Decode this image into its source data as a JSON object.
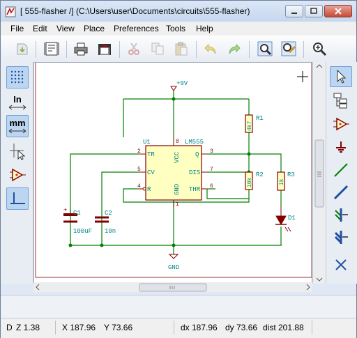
{
  "window": {
    "title": "[ 555-flasher /] (C:\\Users\\user\\Documents\\circuits\\555-flasher)"
  },
  "menu": [
    "File",
    "Edit",
    "View",
    "Place",
    "Preferences",
    "Tools",
    "Help"
  ],
  "toolbar": {
    "icons": [
      "new-sheet-icon",
      "page-settings-icon",
      "print-icon",
      "plot-icon",
      "cut-icon",
      "copy-icon",
      "paste-icon",
      "undo-icon",
      "redo-icon",
      "find-icon",
      "find-replace-icon",
      "zoom-icon"
    ]
  },
  "left_toolbar": {
    "grid_icon": "grid-icon",
    "units_in": "In",
    "units_mm": "mm",
    "cursor_icon": "full-cursor-icon",
    "hier_icon": "hidden-pins-icon",
    "wire_angle_icon": "wire-angle-icon"
  },
  "right_toolbar": {
    "icons": [
      "select-arrow-icon",
      "hierarchy-icon",
      "add-component-icon",
      "add-power-icon",
      "add-wire-icon",
      "add-bus-icon",
      "wire-to-bus-entry-icon",
      "bus-to-bus-entry-icon",
      "no-connect-icon"
    ]
  },
  "schematic": {
    "vcc_label": "+9V",
    "gnd_label": "GND",
    "u1_ref": "U1",
    "u1_value": "LM555",
    "pin_numbers": {
      "tr": "2",
      "cv": "5",
      "r": "4",
      "q": "3",
      "dis": "7",
      "thr": "6",
      "vcc": "8",
      "gnd": "1"
    },
    "pin_names": {
      "tr": "TR",
      "cv": "CV",
      "r": "R",
      "q": "Q",
      "dis": "DIS",
      "thr": "THR",
      "vcc": "VCC",
      "gnd": "GND"
    },
    "r1_ref": "R1",
    "r1_value": "4k7",
    "r2_ref": "R2",
    "r2_value": "10k",
    "r3_ref": "R3",
    "r3_value": "1k",
    "d1_ref": "D1",
    "c1_ref": "C1",
    "c1_value": "100uF",
    "c2_ref": "C2",
    "c2_value": "10n",
    "c1_polarity": "+"
  },
  "status": {
    "zoom": "Z 1.38",
    "cursor_flag": "D",
    "x": "X 187.96",
    "y": "Y 73.66",
    "dx": "dx 187.96",
    "dy": "dy 73.66",
    "dist": "dist 201.88"
  },
  "colors": {
    "wire": "#008000",
    "component_outline": "#840000",
    "component_body": "#ffffc2",
    "pin_text": "#008484",
    "value_text": "#008484"
  }
}
